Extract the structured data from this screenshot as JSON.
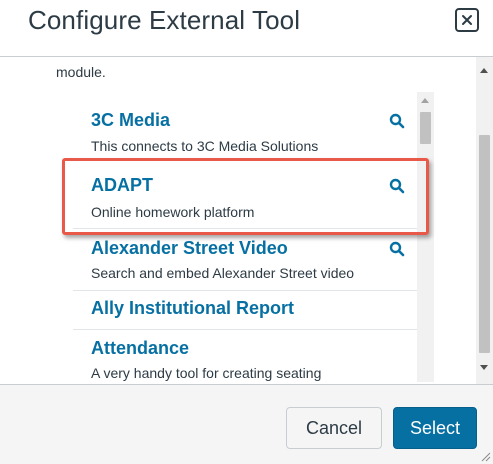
{
  "dialog": {
    "title": "Configure External Tool",
    "close_icon": "close-icon"
  },
  "intro_text": "module.",
  "tools": [
    {
      "name": "3C Media",
      "description": "This connects to 3C Media Solutions",
      "icon": "search-icon"
    },
    {
      "name": "ADAPT",
      "description": "Online homework platform",
      "icon": "search-icon"
    },
    {
      "name": "Alexander Street Video",
      "description": "Search and embed Alexander Street video",
      "icon": "search-icon"
    },
    {
      "name": "Ally Institutional Report",
      "description": ""
    },
    {
      "name": "Attendance",
      "description": "A very handy tool for creating seating"
    }
  ],
  "footer": {
    "cancel_label": "Cancel",
    "select_label": "Select"
  },
  "colors": {
    "link": "#0770a3",
    "primary_button": "#0770a3",
    "highlight": "#e8594a",
    "text": "#2d3b45"
  }
}
